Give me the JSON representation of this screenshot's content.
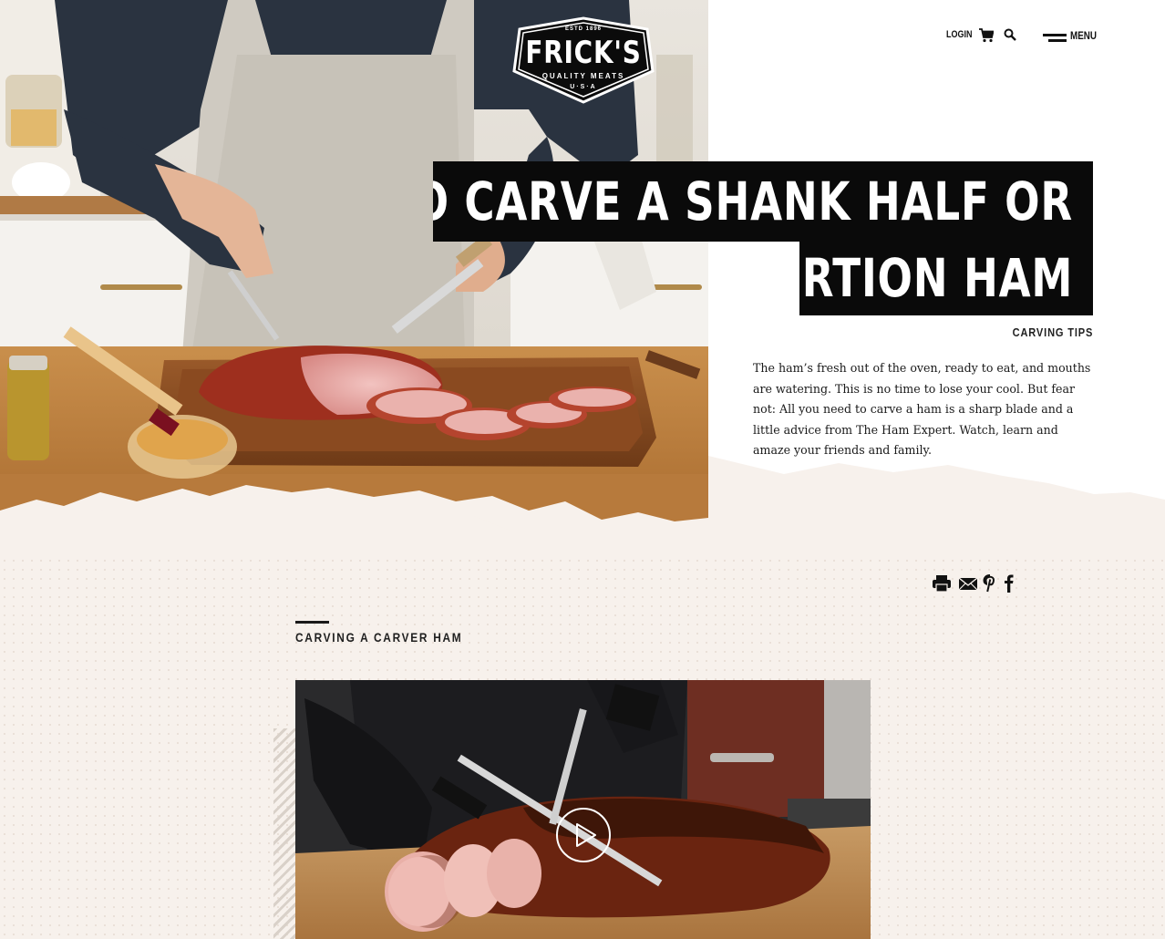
{
  "brand": {
    "name": "FRICK'S",
    "established": "ESTD 1896",
    "tagline": "QUALITY MEATS",
    "country": "U·S·A"
  },
  "nav": {
    "login": "LOGIN",
    "cart_icon": "cart-icon",
    "search_icon": "search-icon",
    "menu_label": "MENU"
  },
  "hero": {
    "title_line1": "HOW TO CARVE A SHANK HALF OR",
    "title_line2": "PORTION HAM",
    "category": "CARVING TIPS",
    "intro": "The ham’s fresh out of the oven, ready to eat, and mouths are watering. This is no time to lose your cool. But fear not: All you need to carve a ham is a sharp blade and a little advice from The Ham Expert. Watch, learn and amaze your friends and family."
  },
  "share": {
    "print_icon": "print-icon",
    "email_icon": "email-icon",
    "pinterest_icon": "pinterest-icon",
    "facebook_icon": "facebook-icon"
  },
  "section": {
    "title": "CARVING A CARVER HAM"
  },
  "video": {
    "play_icon": "play-icon"
  },
  "colors": {
    "title_bg": "#0a0a0a",
    "title_text": "#ffffff",
    "page_bg": "#f7f1ec"
  }
}
